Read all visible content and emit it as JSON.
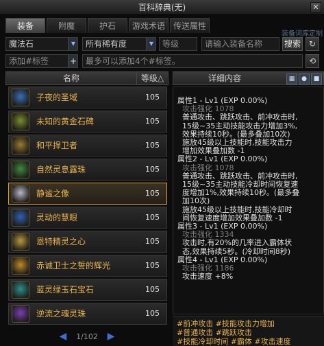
{
  "window": {
    "title": "百科辞典(无)",
    "close_label": "✕"
  },
  "tabs": [
    {
      "label": "装备",
      "active": true
    },
    {
      "label": "附魔",
      "active": false
    },
    {
      "label": "护石",
      "active": false
    },
    {
      "label": "游戏术语",
      "active": false
    },
    {
      "label": "传送属性",
      "active": false
    }
  ],
  "tab_corner_text": "装备词库定制",
  "filters": {
    "category": "魔法石",
    "rarity": "所有稀有度",
    "level": "等级",
    "search_placeholder": "请输入装备名称",
    "search_button": "搜索",
    "refresh_icon": "refresh-icon",
    "add_tag_placeholder": "添加#标签",
    "add_tag_button": "+",
    "tag_hint": "最多可以添加4个#标签。",
    "clear_icon": "clear-icon"
  },
  "list_header": {
    "name": "名称",
    "level": "等级△"
  },
  "items": [
    {
      "name": "子夜的圣域",
      "level": "105",
      "thumb_color": "#3b6fb5"
    },
    {
      "name": "未知的黄金石碑",
      "level": "105",
      "thumb_color": "#7a8f2c"
    },
    {
      "name": "和平捍卫者",
      "level": "105",
      "thumb_color": "#9a7a2e"
    },
    {
      "name": "自然灵息露珠",
      "level": "105",
      "thumb_color": "#3f8a3a"
    },
    {
      "name": "静谧之像",
      "level": "105",
      "thumb_color": "#b8b8c8",
      "selected": true
    },
    {
      "name": "灵动的慧眼",
      "level": "105",
      "thumb_color": "#3060b0"
    },
    {
      "name": "恩特精灵之心",
      "level": "105",
      "thumb_color": "#b89a3a"
    },
    {
      "name": "赤诚卫士之誓的辉光",
      "level": "105",
      "thumb_color": "#c08a20"
    },
    {
      "name": "蓝灵绿玉石宝石",
      "level": "105",
      "thumb_color": "#2c8f8a"
    },
    {
      "name": "逆流之魂灵珠",
      "level": "105",
      "thumb_color": "#7a3fb0"
    }
  ],
  "pager": {
    "prev": "◀",
    "text": "1/102",
    "next": "▶"
  },
  "detail_header": {
    "title": "详细内容",
    "icons": [
      "grid-icon",
      "pin-icon",
      "lock-icon"
    ]
  },
  "detail_lines": [
    {
      "text": "属性1 - Lv1 (EXP 0.00%)",
      "dim": false
    },
    {
      "text": "  攻击强化 1078",
      "dim": true
    },
    {
      "text": "  普通攻击、跳跃攻击、前冲攻击时,",
      "dim": false
    },
    {
      "text": "  15级~35主动技能攻击力增加3%,",
      "dim": false
    },
    {
      "text": "  效果持续10秒。(最多叠加10次)",
      "dim": false
    },
    {
      "text": "  施放45级以上技能时,技能攻击力",
      "dim": false
    },
    {
      "text": "  增加效果叠加数 -1",
      "dim": false
    },
    {
      "text": "属性2 - Lv1 (EXP 0.00%)",
      "dim": false
    },
    {
      "text": "  攻击强化 1078",
      "dim": true
    },
    {
      "text": "  普通攻击、跳跃攻击、前冲攻击时,",
      "dim": false
    },
    {
      "text": "  15级~35主动技能冷却时间恢复速",
      "dim": false
    },
    {
      "text": "  度增加1%,效果持续10秒。(最多叠",
      "dim": false
    },
    {
      "text": "  加10次)",
      "dim": false
    },
    {
      "text": "  施放45级以上技能时,技能冷却时",
      "dim": false
    },
    {
      "text": "  间恢复速度增加效果叠加数 -1",
      "dim": false
    },
    {
      "text": "属性3 - Lv1 (EXP 0.00%)",
      "dim": false
    },
    {
      "text": "  攻击强化 1334",
      "dim": true
    },
    {
      "text": "  攻击时,有20%的几率进入霸体状",
      "dim": false
    },
    {
      "text": "  态,效果持续5秒。(冷却时间8秒)",
      "dim": false
    },
    {
      "text": "属性4 - Lv1 (EXP 0.00%)",
      "dim": false
    },
    {
      "text": "  攻击强化 1186",
      "dim": true
    },
    {
      "text": "  攻击速度 +8%",
      "dim": false
    }
  ],
  "tags": [
    "#前冲攻击 #技能攻击力增加",
    "#普通攻击 #跳跃攻击",
    "#技能冷却时间 #霸体 #攻击速度"
  ]
}
